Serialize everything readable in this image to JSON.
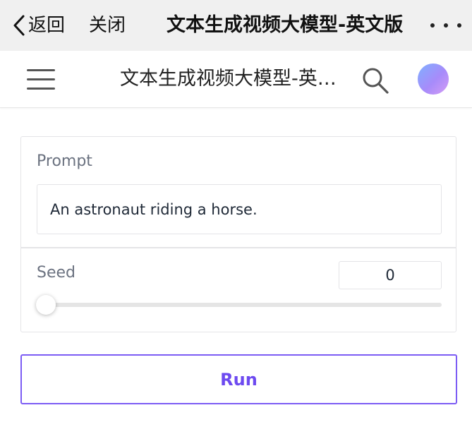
{
  "topbar": {
    "back_label": "返回",
    "close_label": "关闭",
    "title": "文本生成视频大模型-英文版"
  },
  "appbar": {
    "title": "文本生成视频大模型-英文版",
    "avatar_color": "#a78bfa"
  },
  "form": {
    "prompt": {
      "label": "Prompt",
      "value": "An astronaut riding a horse."
    },
    "seed": {
      "label": "Seed",
      "value": "0",
      "slider_fraction": 0
    }
  },
  "actions": {
    "run_label": "Run"
  },
  "colors": {
    "accent": "#6d4af0",
    "topbar_bg": "#f0f0f0"
  }
}
